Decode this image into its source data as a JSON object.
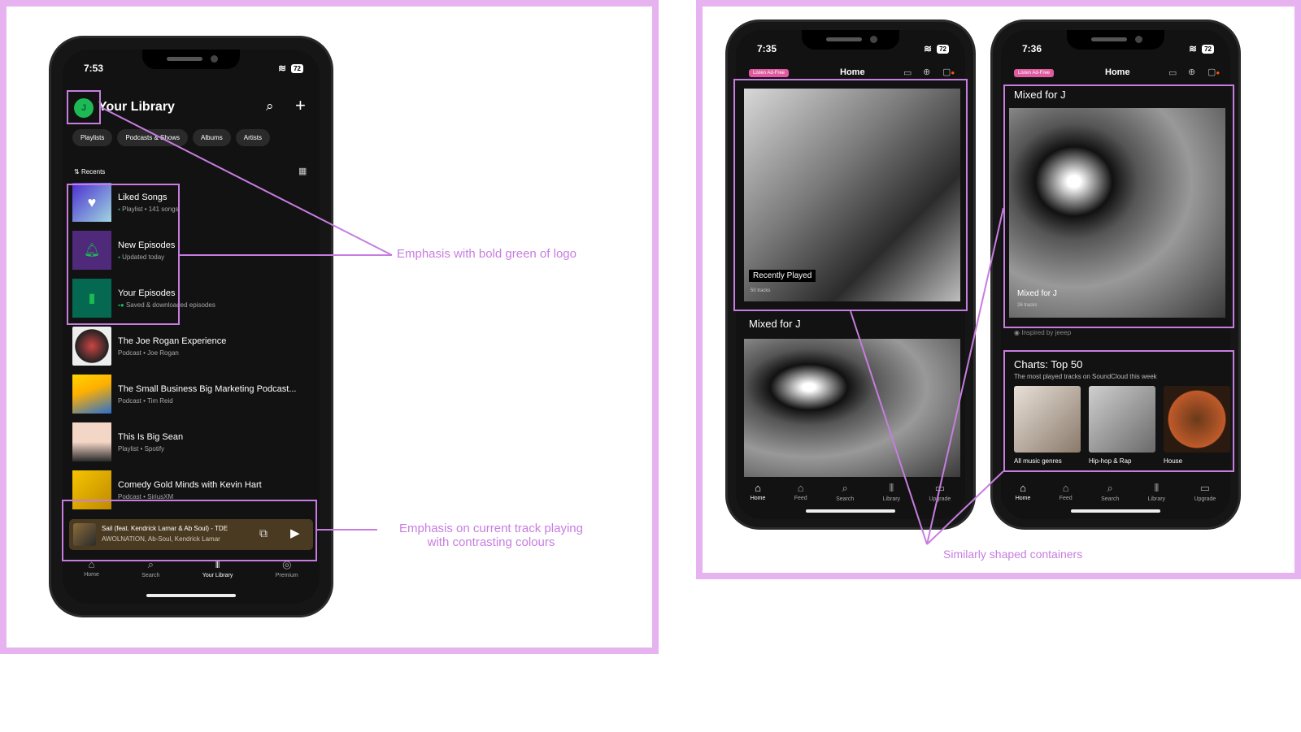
{
  "left_phone": {
    "time": "7:53",
    "battery": "72",
    "header_title": "Your Library",
    "avatar_letter": "J",
    "chips": [
      "Playlists",
      "Podcasts & Shows",
      "Albums",
      "Artists"
    ],
    "sort_label": "Recents",
    "items": [
      {
        "title": "Liked Songs",
        "subtitle": "Playlist • 141 songs"
      },
      {
        "title": "New Episodes",
        "subtitle": "Updated today"
      },
      {
        "title": "Your Episodes",
        "subtitle": "Saved & downloaded episodes"
      },
      {
        "title": "The Joe Rogan Experience",
        "subtitle": "Podcast • Joe Rogan"
      },
      {
        "title": "The Small Business Big Marketing Podcast...",
        "subtitle": "Podcast • Tim Reid"
      },
      {
        "title": "This Is Big Sean",
        "subtitle": "Playlist • Spotify"
      },
      {
        "title": "Comedy Gold Minds with Kevin Hart",
        "subtitle": "Podcast • SiriusXM"
      }
    ],
    "now_playing": {
      "title": "Sail (feat. Kendrick Lamar & Ab Soul) - TDE",
      "artist": "AWOLNATION, Ab-Soul, Kendrick Lamar"
    },
    "nav": [
      "Home",
      "Search",
      "Your Library",
      "Premium"
    ]
  },
  "phone_b": {
    "time": "7:35",
    "battery": "72",
    "tag": "Listen Ad-Free",
    "header_title": "Home",
    "card1_label": "Recently Played",
    "card1_sub": "50 tracks",
    "section2_title": "Mixed for J",
    "nav": [
      "Home",
      "Feed",
      "Search",
      "Library",
      "Upgrade"
    ]
  },
  "phone_c": {
    "time": "7:36",
    "battery": "72",
    "tag": "Listen Ad-Free",
    "header_title": "Home",
    "section1_title": "Mixed for J",
    "card_label": "Mixed for J",
    "card_sub": "26 tracks",
    "inspired": "Inspired by jeeep",
    "charts_title": "Charts: Top 50",
    "charts_sub": "The most played tracks on SoundCloud this week",
    "charts": [
      "All music genres",
      "Hip-hop & Rap",
      "House"
    ],
    "nav": [
      "Home",
      "Feed",
      "Search",
      "Library",
      "Upgrade"
    ]
  },
  "annotations": {
    "logo_green": "Emphasis with bold green of logo",
    "current_track_line1": "Emphasis on current track playing",
    "current_track_line2": "with contrasting colours",
    "containers": "Similarly shaped containers"
  },
  "colors": {
    "accent": "#c77de0",
    "spotify_green": "#1db954",
    "soundcloud_orange": "#ff5500"
  }
}
